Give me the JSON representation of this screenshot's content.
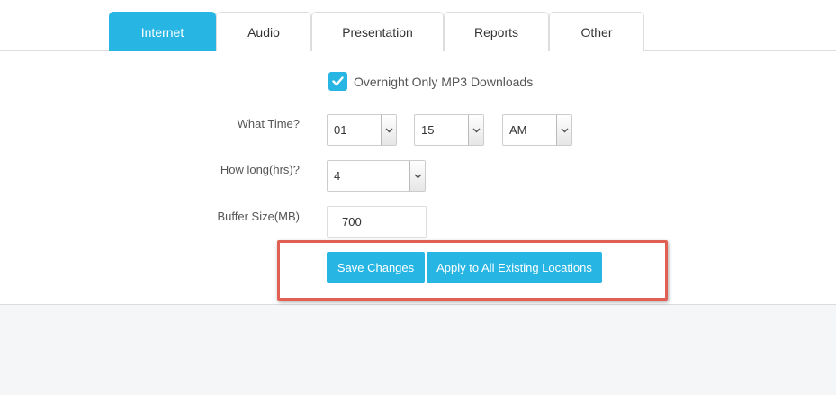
{
  "tabs": [
    {
      "label": "Internet",
      "active": true
    },
    {
      "label": "Audio",
      "active": false
    },
    {
      "label": "Presentation",
      "active": false
    },
    {
      "label": "Reports",
      "active": false
    },
    {
      "label": "Other",
      "active": false
    }
  ],
  "overnight": {
    "label": "Overnight Only MP3 Downloads",
    "checked": true
  },
  "what_time": {
    "label": "What Time?",
    "hour": "01",
    "minute": "15",
    "ampm": "AM"
  },
  "how_long": {
    "label": "How long(hrs)?",
    "value": "4"
  },
  "buffer": {
    "label": "Buffer Size(MB)",
    "value": "700"
  },
  "buttons": {
    "save": "Save Changes",
    "apply_all": "Apply to All Existing Locations"
  },
  "colors": {
    "accent": "#27b6e4",
    "highlight": "#e06055"
  },
  "icons": {
    "checkmark": "check-icon",
    "dropdown": "chevron-down-icon"
  }
}
